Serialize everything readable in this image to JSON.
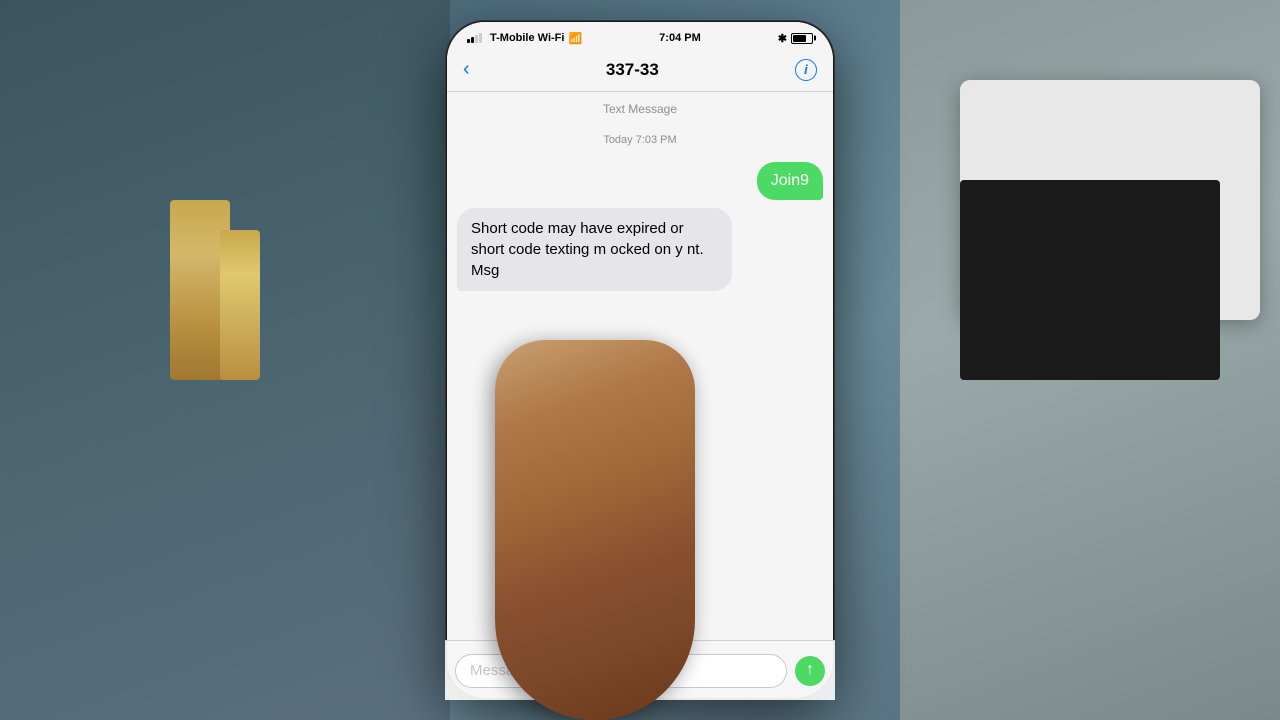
{
  "status_bar": {
    "carrier": "T-Mobile Wi-Fi",
    "wifi": "WiFi",
    "time": "7:04 PM",
    "bluetooth": "✱",
    "battery_level": 70
  },
  "nav": {
    "back_label": "‹",
    "title": "337-33",
    "info_label": "i"
  },
  "message_section": {
    "type_label": "Text Message",
    "timestamp": "Today 7:03 PM"
  },
  "messages": [
    {
      "type": "outgoing",
      "text": "Join9"
    },
    {
      "type": "incoming",
      "text": "Short code may have expired or short code texting m    ocked on y    nt. Msg"
    }
  ],
  "input": {
    "placeholder": "Message"
  },
  "colors": {
    "outgoing_bubble": "#4cd964",
    "incoming_bubble": "#e5e5ea",
    "send_button": "#4cd964",
    "back_color": "#007aff",
    "info_color": "#007aff"
  }
}
